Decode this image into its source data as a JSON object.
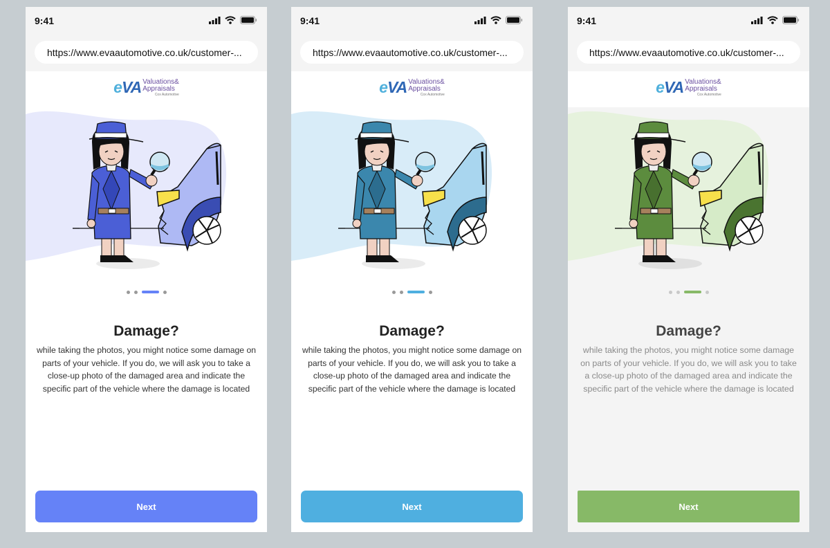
{
  "screens": [
    {
      "time": "9:41",
      "url": "https://www.evaautomotive.co.uk/customer-...",
      "logo": {
        "mark_e": "e",
        "mark_va": "VA",
        "line1": "Valuations&",
        "line2": "Appraisals",
        "tagline": "Cox Automotive"
      },
      "title": "Damage?",
      "body": "while taking the photos, you might notice some damage on parts of your vehicle. If you do, we will ask you to take a close-up photo of the damaged area and indicate the specific part of the vehicle where the damage is located",
      "next_label": "Next",
      "theme": {
        "accent": "#6582f7",
        "blob": "#e7e9fc",
        "outfit": "#4b5fd6",
        "outfit_dark": "#3447b8",
        "car": "#aeb9f4",
        "tire": "#3a4db3"
      },
      "pagination": {
        "total": 4,
        "active": 3
      }
    },
    {
      "time": "9:41",
      "url": "https://www.evaautomotive.co.uk/customer-...",
      "logo": {
        "mark_e": "e",
        "mark_va": "VA",
        "line1": "Valuations&",
        "line2": "Appraisals",
        "tagline": "Cox Automotive"
      },
      "title": "Damage?",
      "body": "while taking the photos, you might notice some damage on parts of your vehicle. If you do, we will ask you to take a close-up photo of the damaged area and indicate the specific part of the vehicle where the damage is located",
      "next_label": "Next",
      "theme": {
        "accent": "#4fafe0",
        "blob": "#d8ecf8",
        "outfit": "#3b87ad",
        "outfit_dark": "#2c6d8f",
        "car": "#a9d6ef",
        "tire": "#2d6c8e"
      },
      "pagination": {
        "total": 4,
        "active": 3
      }
    },
    {
      "time": "9:41",
      "url": "https://www.evaautomotive.co.uk/customer-...",
      "logo": {
        "mark_e": "e",
        "mark_va": "VA",
        "line1": "Valuations&",
        "line2": "Appraisals",
        "tagline": "Cox Automotive"
      },
      "title": "Damage?",
      "body": "while taking the photos, you might notice some damage on parts of your vehicle. If you do, we will ask you to take a close-up photo of the damaged area and indicate the specific part of the vehicle where the damage is located",
      "next_label": "Next",
      "theme": {
        "accent": "#87b967",
        "blob": "#e6f2dd",
        "outfit": "#5c8c3e",
        "outfit_dark": "#48702f",
        "car": "#d6ebc8",
        "tire": "#4a7430"
      },
      "pagination": {
        "total": 4,
        "active": 3
      }
    }
  ]
}
